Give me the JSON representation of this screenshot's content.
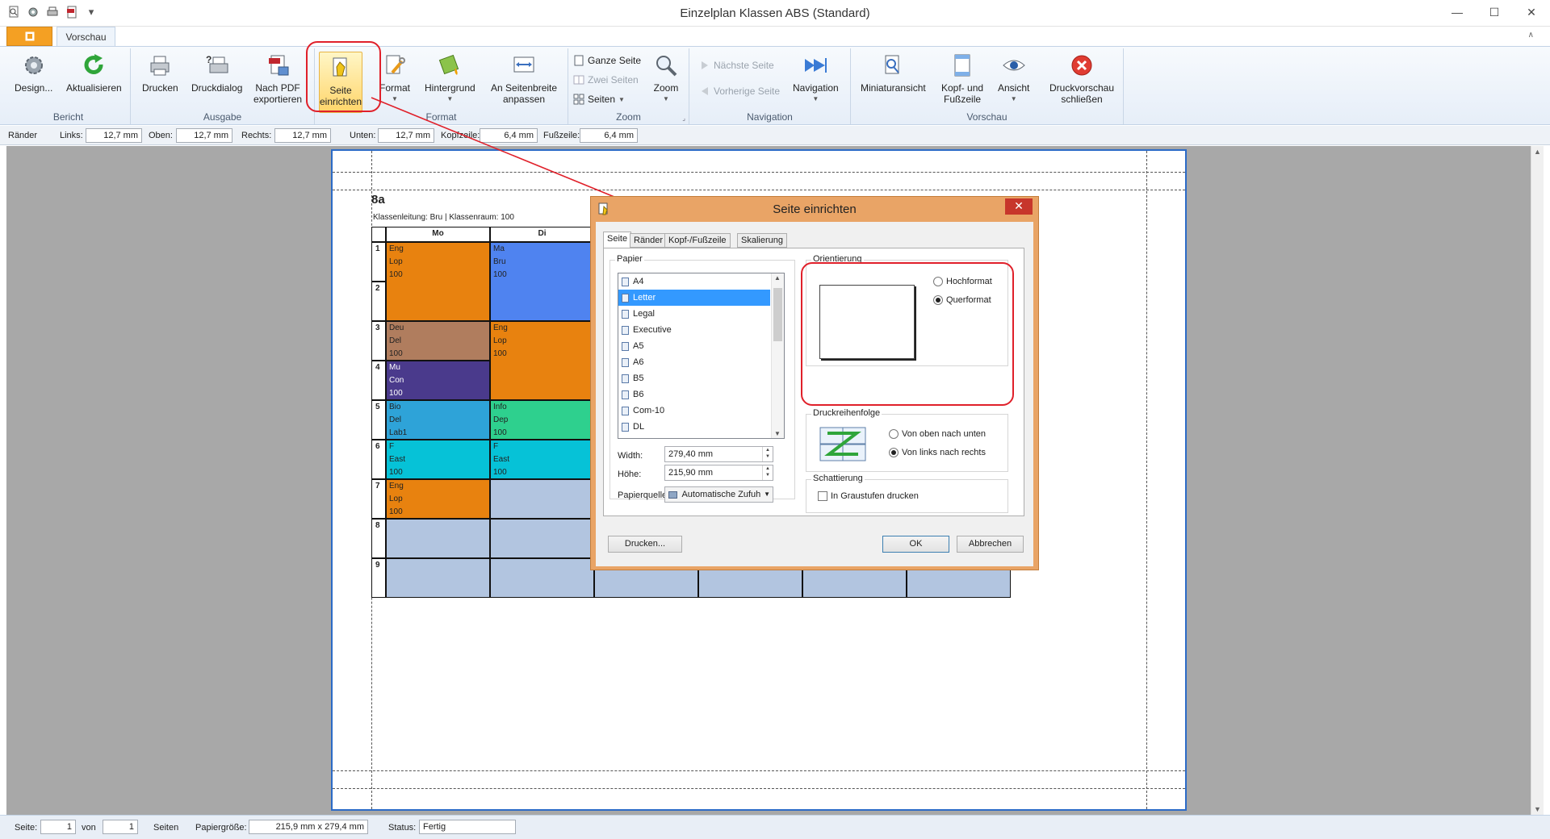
{
  "window": {
    "title": "Einzelplan Klassen ABS (Standard)",
    "minimize": "—",
    "maximize": "☐",
    "close": "✕"
  },
  "ribbon_tabs": {
    "file": "",
    "active": "Vorschau"
  },
  "ribbon": {
    "groups": {
      "bericht": "Bericht",
      "ausgabe": "Ausgabe",
      "format": "Format",
      "zoom": "Zoom",
      "navigation": "Navigation",
      "vorschau": "Vorschau"
    },
    "buttons": {
      "design": "Design...",
      "aktualisieren": "Aktualisieren",
      "drucken": "Drucken",
      "druckdialog": "Druckdialog",
      "pdf_line1": "Nach PDF",
      "pdf_line2": "exportieren",
      "seite_line1": "Seite",
      "seite_line2": "einrichten",
      "format": "Format",
      "hintergrund": "Hintergrund",
      "seitenbreite_line1": "An Seitenbreite",
      "seitenbreite_line2": "anpassen",
      "ganze_seite": "Ganze Seite",
      "zwei_seiten": "Zwei Seiten",
      "seiten": "Seiten",
      "zoom": "Zoom",
      "naechste_seite": "Nächste Seite",
      "vorherige_seite": "Vorherige Seite",
      "navigation": "Navigation",
      "miniaturansicht": "Miniaturansicht",
      "kopf_line1": "Kopf- und",
      "kopf_line2": "Fußzeile",
      "ansicht": "Ansicht",
      "schliessen_line1": "Druckvorschau",
      "schliessen_line2": "schließen"
    }
  },
  "margins": {
    "raender_label": "Ränder",
    "links_label": "Links:",
    "links": "12,7 mm",
    "oben_label": "Oben:",
    "oben": "12,7 mm",
    "rechts_label": "Rechts:",
    "rechts": "12,7 mm",
    "unten_label": "Unten:",
    "unten": "12,7 mm",
    "kopfzeile_label": "Kopfzeile:",
    "kopfzeile": "6,4 mm",
    "fusszeile_label": "Fußzeile:",
    "fusszeile": "6,4 mm"
  },
  "report": {
    "class_name": "8a",
    "class_info": "Klassenleitung: Bru | Klassenraum: 100",
    "days": [
      "Mo",
      "Di"
    ],
    "periods": [
      "1",
      "2",
      "3",
      "4",
      "5",
      "6",
      "7",
      "8",
      "9"
    ],
    "mo": [
      {
        "lines": [
          "Eng",
          "Lop",
          "100"
        ],
        "color": "#e8820f"
      },
      {
        "lines": [
          "Deu",
          "Del",
          "100"
        ],
        "color": "#b07d5e"
      },
      {
        "lines": [
          "Mu",
          "Con",
          "100"
        ],
        "color": "#4a3a8c"
      },
      {
        "lines": [
          "Bio",
          "Del",
          "Lab1"
        ],
        "color": "#2ea3d8"
      },
      {
        "lines": [
          "F",
          "East",
          "100"
        ],
        "color": "#06c2d7"
      },
      {
        "lines": [
          "Eng",
          "Lop",
          "100"
        ],
        "color": "#e8820f"
      }
    ],
    "di": [
      {
        "lines": [
          "Ma",
          "Bru",
          "100"
        ],
        "color": "#4f83f0"
      },
      {
        "lines": [
          "Eng",
          "Lop",
          "100"
        ],
        "color": "#e8820f"
      },
      {
        "lines": [
          "Info",
          "Dep",
          "100"
        ],
        "color": "#2ed08e"
      },
      {
        "lines": [
          "F",
          "East",
          "100"
        ],
        "color": "#06c2d7"
      }
    ],
    "empty_color": "#b2c5e0"
  },
  "dialog": {
    "title": "Seite einrichten",
    "close": "✕",
    "tabs": [
      "Seite",
      "Ränder",
      "Kopf-/Fußzeile",
      "Skalierung"
    ],
    "papier_label": "Papier",
    "paper_sizes": [
      "A4",
      "Letter",
      "Legal",
      "Executive",
      "A5",
      "A6",
      "B5",
      "B6",
      "Com-10",
      "DL"
    ],
    "selected_paper": "Letter",
    "width_label": "Width:",
    "width": "279,40 mm",
    "hoehe_label": "Höhe:",
    "hoehe": "215,90 mm",
    "papierquelle_label": "Papierquelle:",
    "papierquelle": "Automatische Zufuh",
    "orientierung_label": "Orientierung",
    "hochformat": "Hochformat",
    "querformat": "Querformat",
    "druckreihenfolge_label": "Druckreihenfolge",
    "von_oben": "Von oben nach unten",
    "von_links": "Von links nach rechts",
    "schattierung_label": "Schattierung",
    "graustufen": "In Graustufen drucken",
    "drucken_btn": "Drucken...",
    "ok_btn": "OK",
    "abbrechen_btn": "Abbrechen"
  },
  "status": {
    "seite_label": "Seite:",
    "seite": "1",
    "von_label": "von",
    "von": "1",
    "seiten_label": "Seiten",
    "papiergroesse_label": "Papiergröße:",
    "papiergroesse": "215,9 mm x 279,4 mm",
    "status_label": "Status:",
    "status": "Fertig"
  },
  "colors": {
    "accent_red": "#e0202a",
    "file_tab": "#f4a023",
    "dialog_frame": "#e9a466",
    "selection": "#3399ff"
  }
}
